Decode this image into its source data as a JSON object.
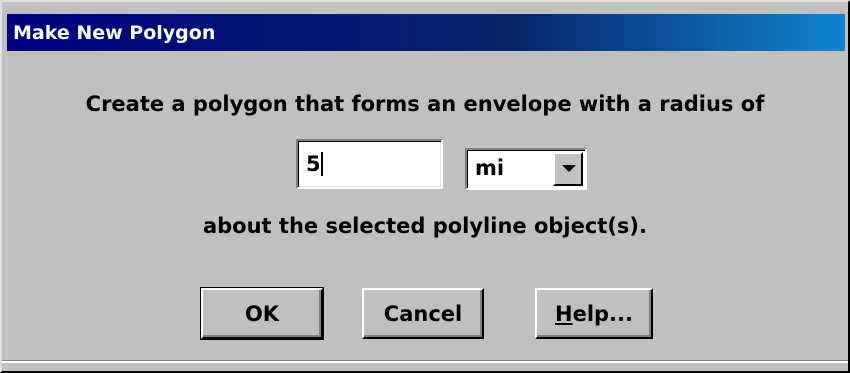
{
  "window": {
    "title": "Make New Polygon"
  },
  "dialog": {
    "prompt_line_1": "Create a polygon that forms an envelope with a radius of",
    "radius_value": "5",
    "units_selected": "mi",
    "prompt_line_2": "about the selected polyline object(s)."
  },
  "buttons": {
    "ok_label": "OK",
    "cancel_label": "Cancel",
    "help_label_prefix": "H",
    "help_label_rest": "elp..."
  },
  "icons": {
    "dropdown": "chevron-down-icon"
  },
  "colors": {
    "titlebar": "#000080",
    "face": "#c0c0c0"
  }
}
